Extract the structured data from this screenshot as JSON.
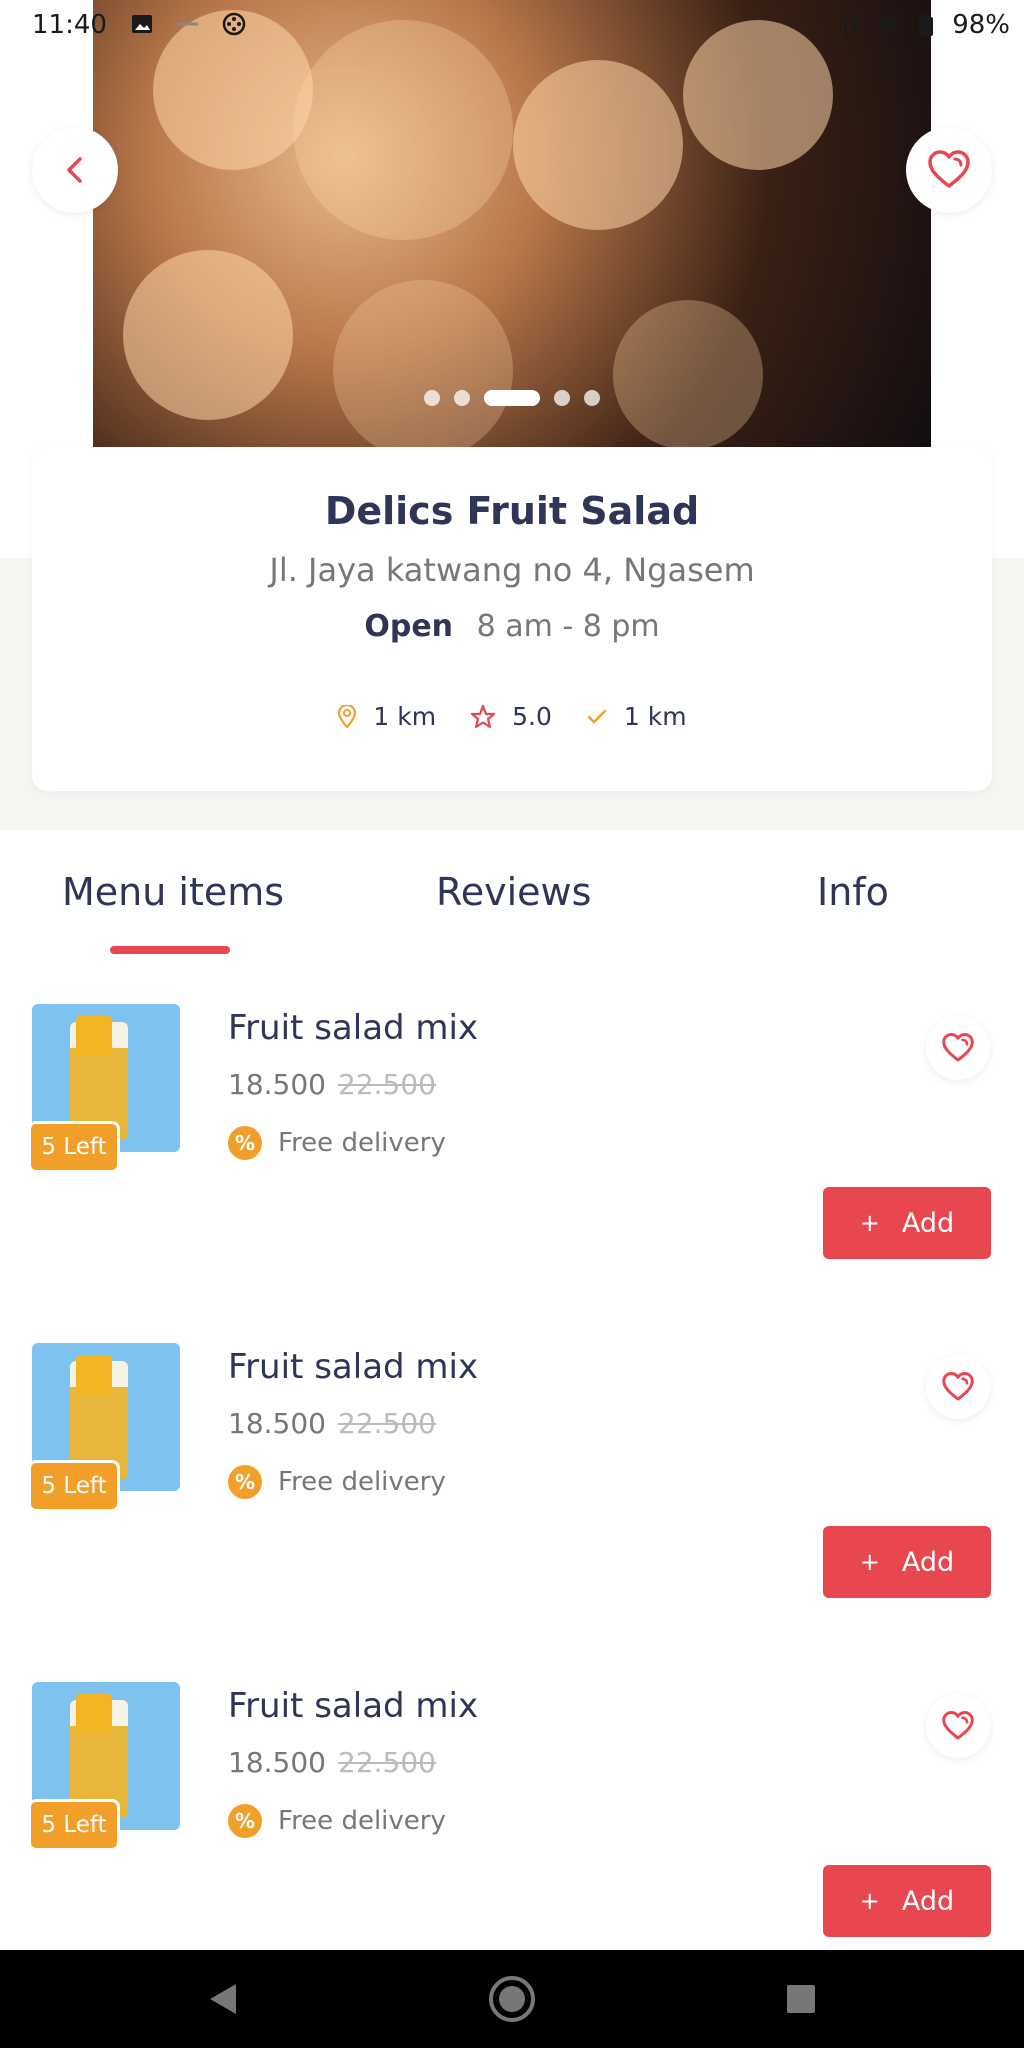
{
  "status_bar": {
    "time": "11:40",
    "battery": "98%",
    "icons_left": [
      "image-icon",
      "cast-icon",
      "film-reel-icon"
    ],
    "icons_right": [
      "vibrate-icon",
      "wifi-icon",
      "battery-icon"
    ]
  },
  "carousel": {
    "slides": 5,
    "active_slide": 3
  },
  "store": {
    "name": "Delics Fruit Salad",
    "address": "Jl. Jaya katwang no 4, Ngasem",
    "hours_label": "Open",
    "hours": "8 am - 8 pm",
    "distance": "1 km",
    "rating": "5.0",
    "delivery_distance": "1 km"
  },
  "tabs": {
    "menu": "Menu items",
    "reviews": "Reviews",
    "info": "Info",
    "active": "menu"
  },
  "menu_items": [
    {
      "title": "Fruit salad mix",
      "price": "18.500",
      "old_price": "22.500",
      "stock": "5  Left",
      "delivery": "Free delivery",
      "promo_symbol": "%",
      "add_label": "Add",
      "add_symbol": "+"
    },
    {
      "title": "Fruit salad mix",
      "price": "18.500",
      "old_price": "22.500",
      "stock": "5  Left",
      "delivery": "Free delivery",
      "promo_symbol": "%",
      "add_label": "Add",
      "add_symbol": "+"
    },
    {
      "title": "Fruit salad mix",
      "price": "18.500",
      "old_price": "22.500",
      "stock": "5  Left",
      "delivery": "Free delivery",
      "promo_symbol": "%",
      "add_label": "Add",
      "add_symbol": "+"
    }
  ],
  "colors": {
    "accent": "#e8474f",
    "orange": "#f29f2a",
    "text_dark": "#2f3556",
    "text_muted": "#777777",
    "panel_bg": "#f7f5f2"
  }
}
